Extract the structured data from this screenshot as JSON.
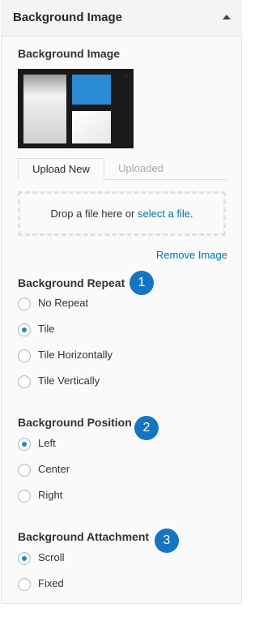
{
  "panel": {
    "title": "Background Image",
    "collapse_icon": "triangle-up-icon"
  },
  "image_section": {
    "label": "Background Image",
    "thumbnail_dropdown_icon": "caret-down-icon"
  },
  "tabs": [
    {
      "label": "Upload New",
      "active": true
    },
    {
      "label": "Uploaded",
      "active": false
    }
  ],
  "dropzone": {
    "text": "Drop a file here or ",
    "link": "select a file",
    "suffix": "."
  },
  "remove_label": "Remove Image",
  "repeat": {
    "label": "Background Repeat",
    "badge": "1",
    "options": [
      {
        "label": "No Repeat",
        "checked": false
      },
      {
        "label": "Tile",
        "checked": true
      },
      {
        "label": "Tile Horizontally",
        "checked": false
      },
      {
        "label": "Tile Vertically",
        "checked": false
      }
    ]
  },
  "position": {
    "label": "Background Position",
    "badge": "2",
    "options": [
      {
        "label": "Left",
        "checked": true
      },
      {
        "label": "Center",
        "checked": false
      },
      {
        "label": "Right",
        "checked": false
      }
    ]
  },
  "attachment": {
    "label": "Background Attachment",
    "badge": "3",
    "options": [
      {
        "label": "Scroll",
        "checked": true
      },
      {
        "label": "Fixed",
        "checked": false
      }
    ]
  },
  "colors": {
    "accent": "#1575c2",
    "link": "#0073aa",
    "radio_dot": "#1e8cbe"
  }
}
